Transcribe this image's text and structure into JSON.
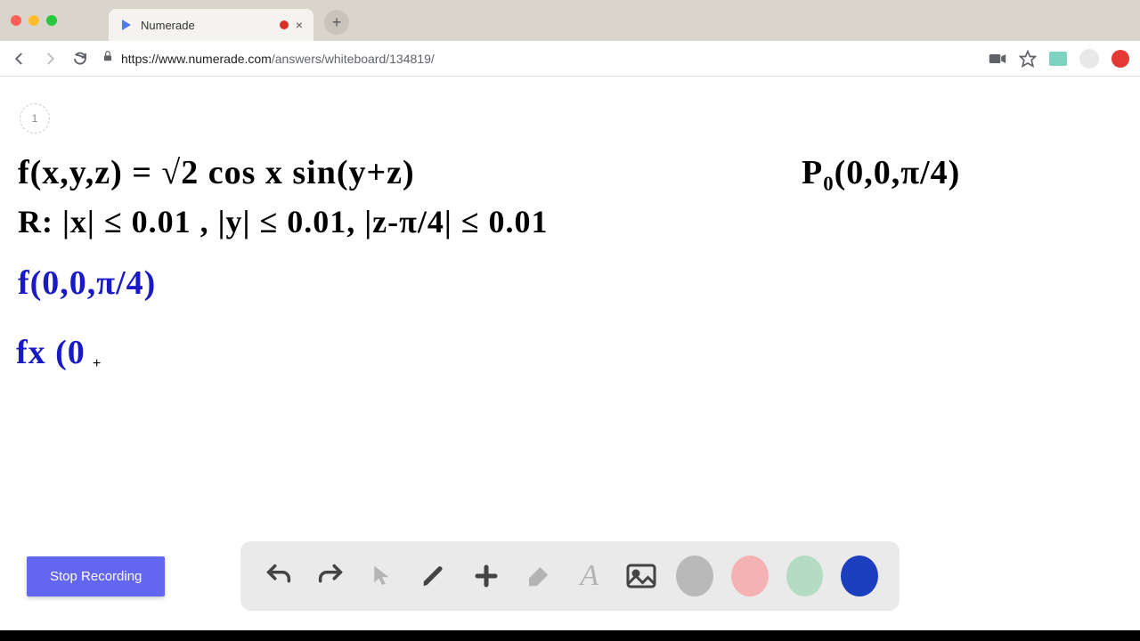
{
  "browser": {
    "tab": {
      "title": "Numerade",
      "recording": true
    },
    "url": {
      "host": "https://www.numerade.com",
      "path": "/answers/whiteboard/134819/"
    },
    "new_tab_symbol": "+",
    "tab_close_symbol": "×"
  },
  "page": {
    "page_number": "1",
    "stop_recording_label": "Stop Recording"
  },
  "whiteboard": {
    "line1": "f(x,y,z) = √2 cos x sin(y+z)",
    "line1_right": "P₀(0,0,π/4)",
    "line2": "R: |x| ≤ 0.01 ,  |y| ≤ 0.01,  |z-π/4| ≤ 0.01",
    "line3": "f(0,0,π/4)",
    "line4": "fx (0",
    "cursor_symbol": "+"
  },
  "toolbar": {
    "undo": "↶",
    "redo": "↷",
    "cursor": "↖",
    "pen": "✎",
    "plus": "+",
    "eraser": "◊",
    "text": "A",
    "image": "🖼",
    "colors": {
      "gray": "#b9b9b9",
      "pink": "#f5b2b2",
      "green": "#b3dcc2",
      "blue": "#1c3fbf"
    }
  }
}
